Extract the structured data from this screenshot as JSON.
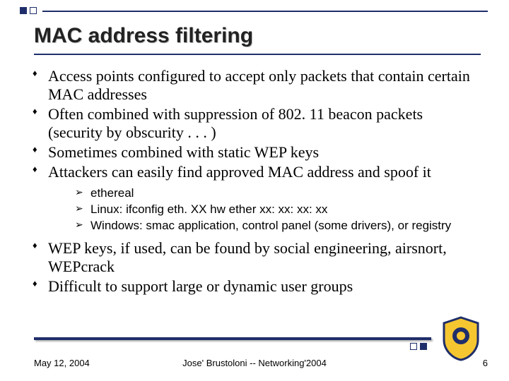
{
  "title": "MAC address filtering",
  "bullets": {
    "b1": "Access points configured to accept only packets that contain certain MAC addresses",
    "b2": "Often combined with suppression of 802. 11 beacon packets (security by obscurity . . . )",
    "b3": "Sometimes combined with static WEP keys",
    "b4": "Attackers can easily find approved MAC address and spoof it",
    "sub": {
      "s1": "ethereal",
      "s2": "Linux: ifconfig eth. XX hw ether xx: xx: xx: xx",
      "s3": "Windows: smac application, control panel (some drivers), or registry"
    },
    "b5": "WEP keys, if used, can be found by social engineering, airsnort, WEPcrack",
    "b6": "Difficult to support large or dynamic user groups"
  },
  "footer": {
    "date": "May 12, 2004",
    "center": "Jose' Brustoloni -- Networking'2004",
    "page": "6"
  }
}
